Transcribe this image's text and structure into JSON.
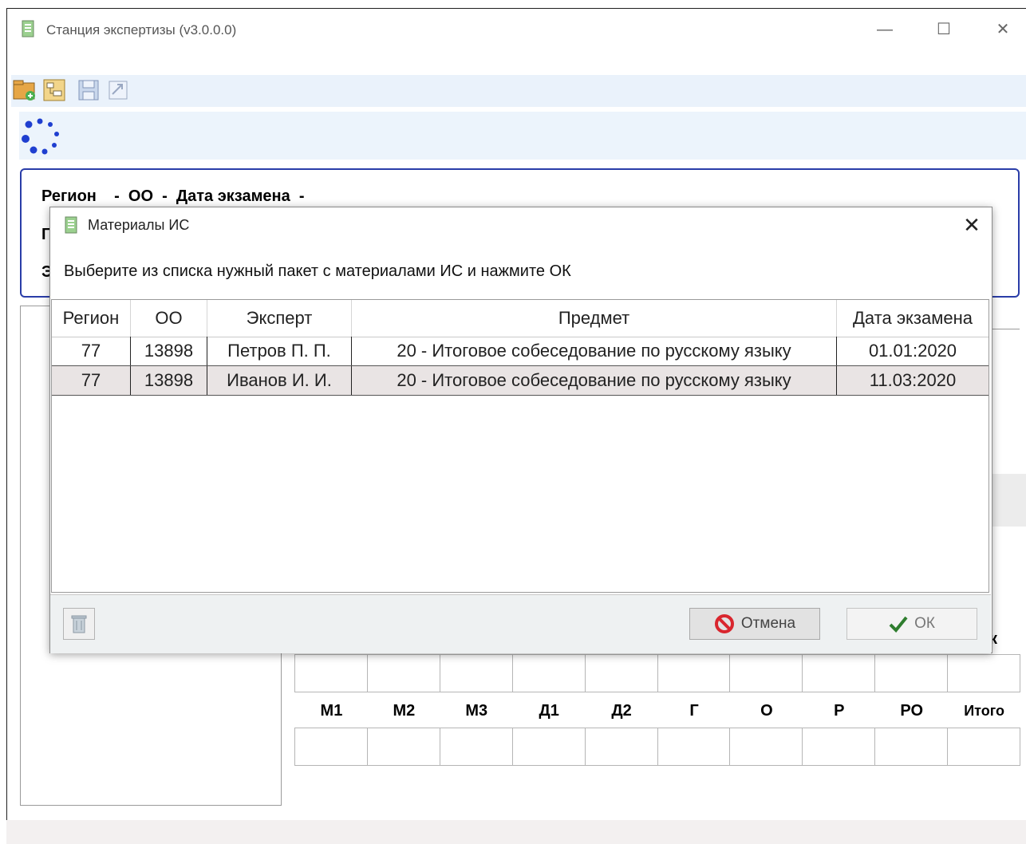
{
  "window": {
    "title": "Станция экспертизы (v3.0.0.0)",
    "minimize_glyph": "—",
    "maximize_glyph": "☐",
    "close_glyph": "✕"
  },
  "info": {
    "line1": "Регион    -  ОО  -  Дата экзамена  -",
    "line2_visible": "Г",
    "line3_visible": "Э"
  },
  "scores": {
    "labels": [
      "М1",
      "М2",
      "М3",
      "Д1",
      "Д2",
      "Г",
      "О",
      "Р",
      "РО",
      "Итого"
    ],
    "partial_label": "к"
  },
  "dialog": {
    "title": "Материалы ИС",
    "close_glyph": "✕",
    "instruction": "Выберите из списка нужный пакет с материалами ИС и нажмите ОК",
    "columns": [
      "Регион",
      "ОО",
      "Эксперт",
      "Предмет",
      "Дата экзамена"
    ],
    "rows": [
      [
        "77",
        "13898",
        "Петров П. П.",
        "20 - Итоговое собеседование по русскому языку",
        "01.01:2020"
      ],
      [
        "77",
        "13898",
        "Иванов И. И.",
        "20 - Итоговое собеседование по русскому языку",
        "11.03:2020"
      ]
    ],
    "selected_row": 1,
    "cancel_label": "Отмена",
    "ok_label": "ОК"
  },
  "icons": {
    "app": "app-icon",
    "toolbar": [
      "open-package-icon",
      "tree-icon",
      "save-icon",
      "export-icon"
    ],
    "loading": "loading-spinner-icon",
    "trash": "trash-icon",
    "cancel": "cancel-icon",
    "ok": "checkmark-icon"
  },
  "colors": {
    "accent_border": "#2a3da8",
    "selected_row": "#e9e4e4",
    "cancel_red": "#d9262e",
    "ok_green": "#2e7d2e",
    "spinner": "#1f3fd0"
  }
}
